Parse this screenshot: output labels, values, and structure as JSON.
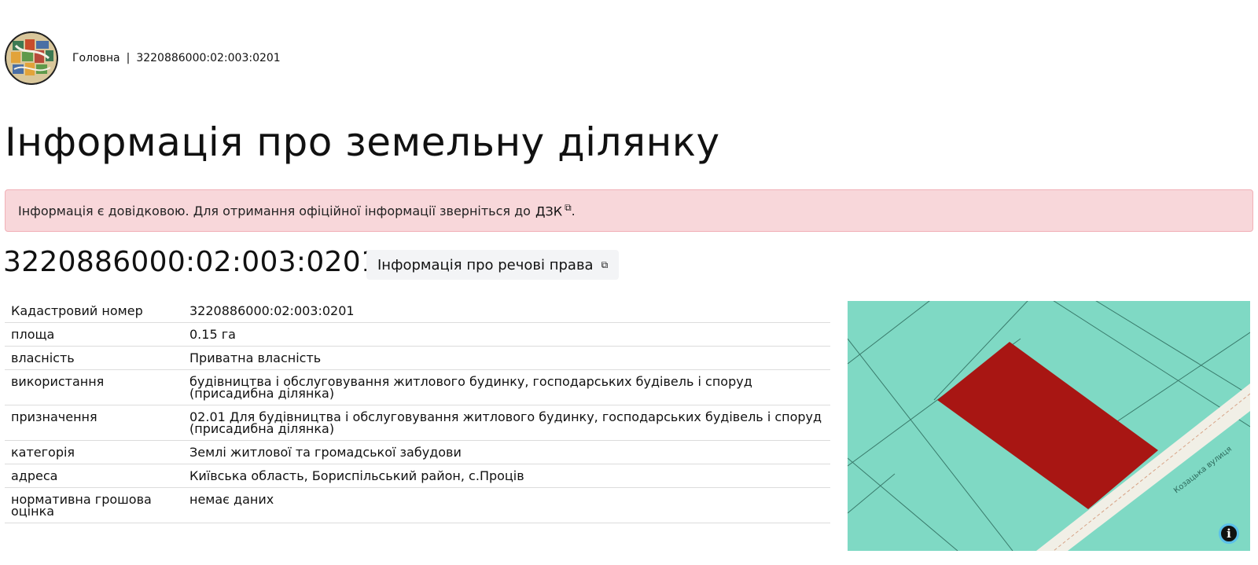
{
  "breadcrumb": {
    "home": "Головна",
    "separator": "|",
    "current": "3220886000:02:003:0201"
  },
  "page_title": "Інформація про земельну ділянку",
  "alert": {
    "text": "Інформація є довідковою. Для отримання офіційної інформації зверніться до",
    "link": "ДЗК",
    "end": "."
  },
  "parcel": {
    "id": "3220886000:02:003:0201",
    "rights_button": "Інформація про речові права"
  },
  "table": {
    "rows": [
      {
        "key": "Кадастровий номер",
        "value": "3220886000:02:003:0201"
      },
      {
        "key": "площа",
        "value": "0.15 га"
      },
      {
        "key": "власність",
        "value": "Приватна власність"
      },
      {
        "key": "використання",
        "value": "будівництва і обслуговування житлового будинку, господарських будівель і споруд (присадибна ділянка)"
      },
      {
        "key": "призначення",
        "value": "02.01 Для будівництва і обслуговування житлового будинку, господарських будівель і споруд (присадибна ділянка)"
      },
      {
        "key": "категорія",
        "value": "Землі житлової та громадської забудови"
      },
      {
        "key": "адреса",
        "value": "Київська область, Бориспільський район, с.Проців"
      },
      {
        "key": "нормативна грошова оцінка",
        "value": "немає даних"
      }
    ]
  },
  "map": {
    "street_label": "Козацька вулиця",
    "info_glyph": "i"
  },
  "colors": {
    "alert_bg": "#f8d7da",
    "map_land": "#7fd9c4",
    "parcel": "#a81613",
    "road": "#f1efe6"
  }
}
